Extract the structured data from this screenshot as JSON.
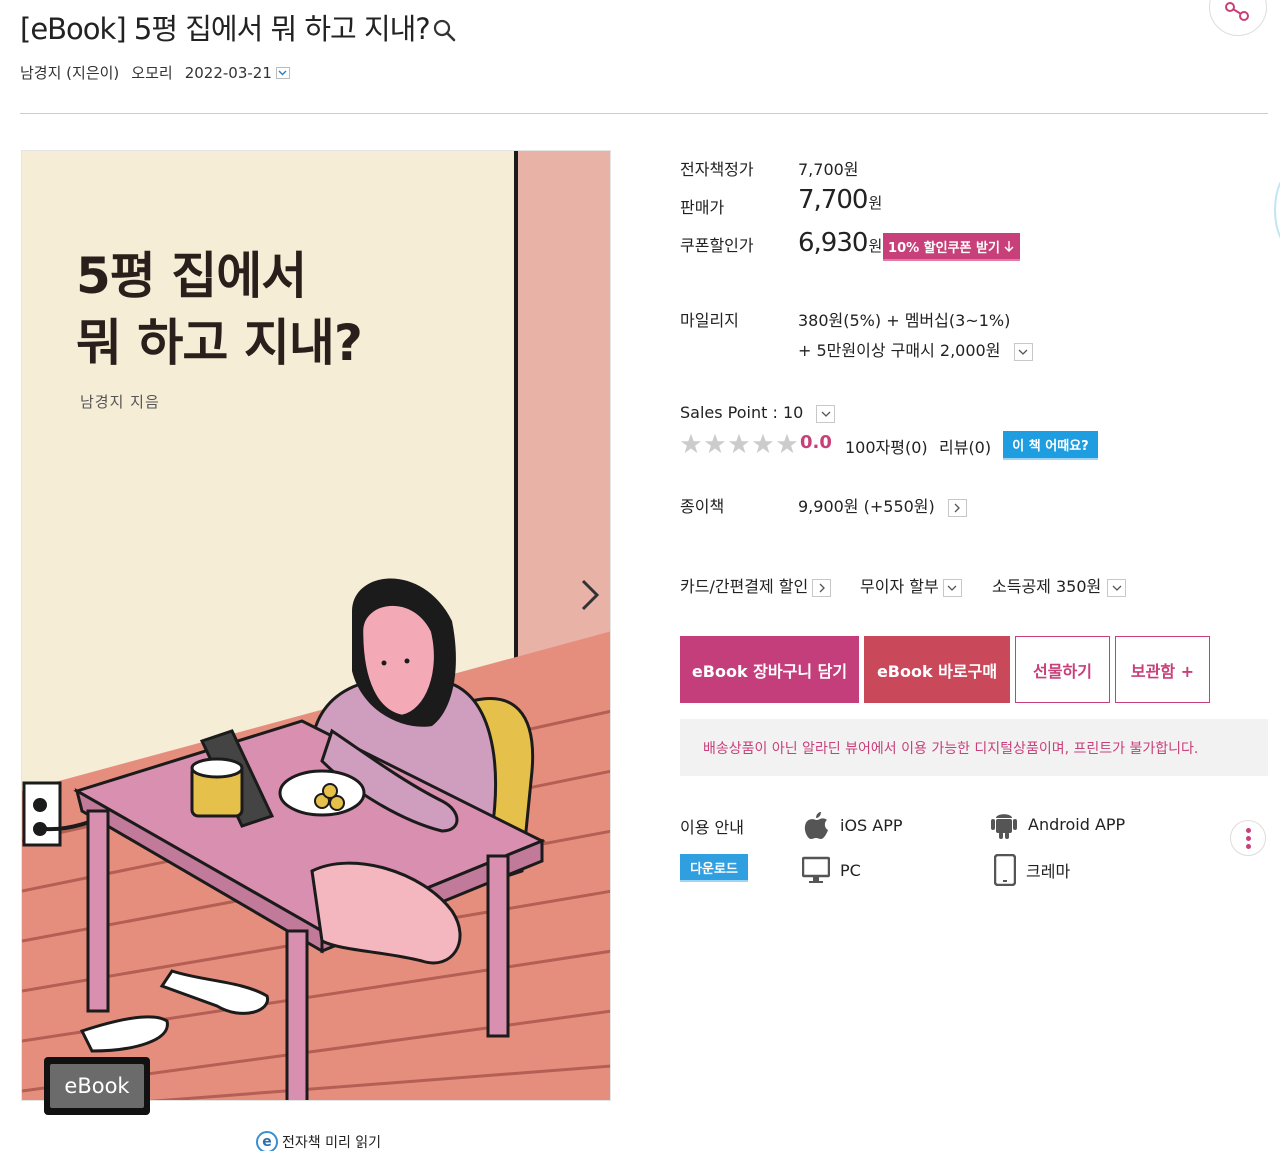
{
  "header": {
    "title": "[eBook] 5평 집에서 뭐 하고 지내?",
    "author": "남경지 (지은이)",
    "publisher": "오모리",
    "date": "2022-03-21"
  },
  "cover": {
    "title_line1": "5평 집에서",
    "title_line2": "뭐 하고 지내?",
    "author": "남경지  지음",
    "badge": "eBook",
    "preview_icon": "e",
    "preview_label": "전자책 미리 읽기"
  },
  "price": {
    "ebook_price_label": "전자책정가",
    "ebook_price_value": "7,700원",
    "sale_label": "판매가",
    "sale_value": "7,700",
    "sale_unit": "원",
    "coupon_label": "쿠폰할인가",
    "coupon_value": "6,930",
    "coupon_unit": "원",
    "coupon_button": "10% 할인쿠폰 받기"
  },
  "mileage": {
    "label": "마일리지",
    "line1": "380원(5%) + 멤버십(3~1%)",
    "line2": "+ 5만원이상 구매시 2,000원"
  },
  "sales": {
    "label": "Sales Point : 10",
    "rating": 0,
    "max_rating": 5,
    "score": "0.0",
    "comments": "100자평(0)",
    "reviews": "리뷰(0)",
    "how_button": "이 책 어때요?"
  },
  "paper": {
    "label": "종이책",
    "value": "9,900원 (+550원)"
  },
  "payment": {
    "card": "카드/간편결제 할인",
    "installment": "무이자 할부",
    "tax": "소득공제 350원"
  },
  "actions": {
    "cart": "eBook 장바구니 담기",
    "buy": "eBook 바로구매",
    "gift": "선물하기",
    "save": "보관함 +"
  },
  "notice": "배송상품이 아닌 알라딘 뷰어에서 이용 가능한 디지털상품이며, 프린트가 불가합니다.",
  "usage": {
    "label": "이용 안내",
    "download": "다운로드",
    "ios": "iOS APP",
    "android": "Android APP",
    "pc": "PC",
    "crema": "크레마"
  },
  "colors": {
    "accent": "#c8407a",
    "buy": "#c9485a",
    "blue": "#1e9de0"
  }
}
